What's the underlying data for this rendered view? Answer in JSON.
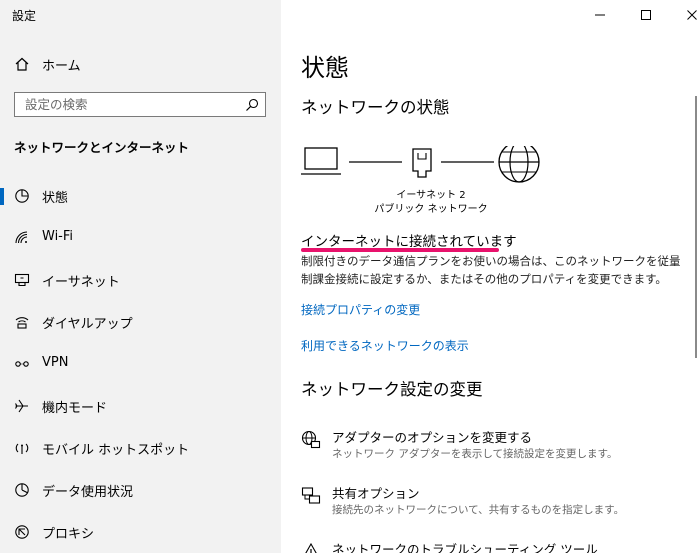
{
  "window": {
    "title": "設定"
  },
  "sidebar": {
    "home_label": "ホーム",
    "search_placeholder": "設定の検索",
    "section_title": "ネットワークとインターネット",
    "items": [
      {
        "label": "状態",
        "icon": "status-icon",
        "active": true
      },
      {
        "label": "Wi-Fi",
        "icon": "wifi-icon"
      },
      {
        "label": "イーサネット",
        "icon": "ethernet-icon"
      },
      {
        "label": "ダイヤルアップ",
        "icon": "dialup-icon"
      },
      {
        "label": "VPN",
        "icon": "vpn-icon"
      },
      {
        "label": "機内モード",
        "icon": "airplane-icon"
      },
      {
        "label": "モバイル ホットスポット",
        "icon": "hotspot-icon"
      },
      {
        "label": "データ使用状況",
        "icon": "data-usage-icon"
      },
      {
        "label": "プロキシ",
        "icon": "proxy-icon"
      }
    ]
  },
  "main": {
    "page_title": "状態",
    "network_status_heading": "ネットワークの状態",
    "diagram": {
      "adapter_name": "イーサネット 2",
      "network_type": "パブリック ネットワーク"
    },
    "connection_status": "インターネットに接続されています",
    "description": "制限付きのデータ通信プランをお使いの場合は、このネットワークを従量制課金接続に設定するか、またはその他のプロパティを変更できます。",
    "links": {
      "change_properties": "接続プロパティの変更",
      "show_networks": "利用できるネットワークの表示"
    },
    "change_settings_heading": "ネットワーク設定の変更",
    "options": [
      {
        "title": "アダプターのオプションを変更する",
        "subtitle": "ネットワーク アダプターを表示して接続設定を変更します。",
        "icon": "adapter-options-icon"
      },
      {
        "title": "共有オプション",
        "subtitle": "接続先のネットワークについて、共有するものを指定します。",
        "icon": "sharing-icon"
      },
      {
        "title": "ネットワークのトラブルシューティング ツール",
        "subtitle": "",
        "icon": "troubleshoot-icon"
      }
    ]
  },
  "colors": {
    "accent": "#0067c0",
    "highlight_underline": "#e8126c",
    "sidebar_bg": "#f2f2f2"
  }
}
